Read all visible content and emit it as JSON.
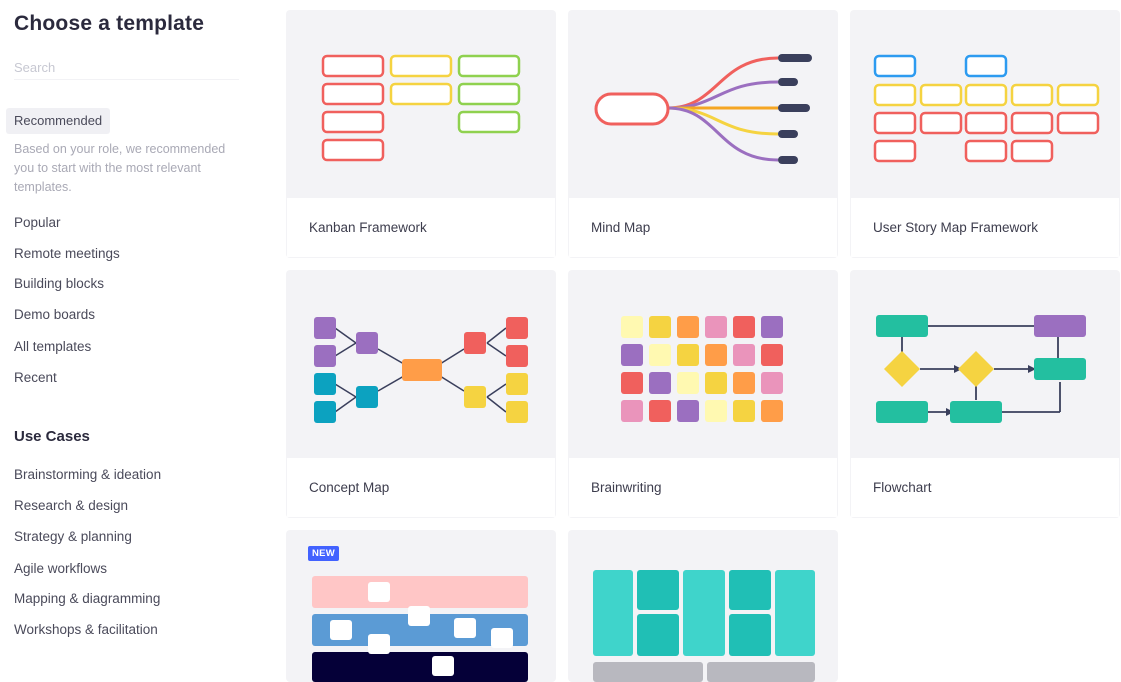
{
  "sidebar": {
    "title": "Choose a template",
    "search_placeholder": "Search",
    "recommended": {
      "label": "Recommended",
      "description": "Based on your role, we recommended you to start with the most relevant templates."
    },
    "nav": [
      "Popular",
      "Remote meetings",
      "Building blocks",
      "Demo boards",
      "All templates",
      "Recent"
    ],
    "use_cases_title": "Use Cases",
    "use_cases": [
      "Brainstorming & ideation",
      "Research & design",
      "Strategy & planning",
      "Agile workflows",
      "Mapping & diagramming",
      "Workshops & facilitation"
    ]
  },
  "templates": [
    {
      "name": "Kanban Framework"
    },
    {
      "name": "Mind Map"
    },
    {
      "name": "User Story Map Framework"
    },
    {
      "name": "Concept Map"
    },
    {
      "name": "Brainwriting"
    },
    {
      "name": "Flowchart"
    },
    {
      "name": "",
      "badge": "NEW"
    },
    {
      "name": ""
    }
  ],
  "colors": {
    "accent_badge": "#4262ff",
    "red": "#f0605d",
    "yellow": "#f5d341",
    "green": "#8fd14f",
    "blue": "#2d9bf0",
    "teal": "#12cdd4",
    "purple": "#9b6fc0",
    "navy": "#050038"
  }
}
